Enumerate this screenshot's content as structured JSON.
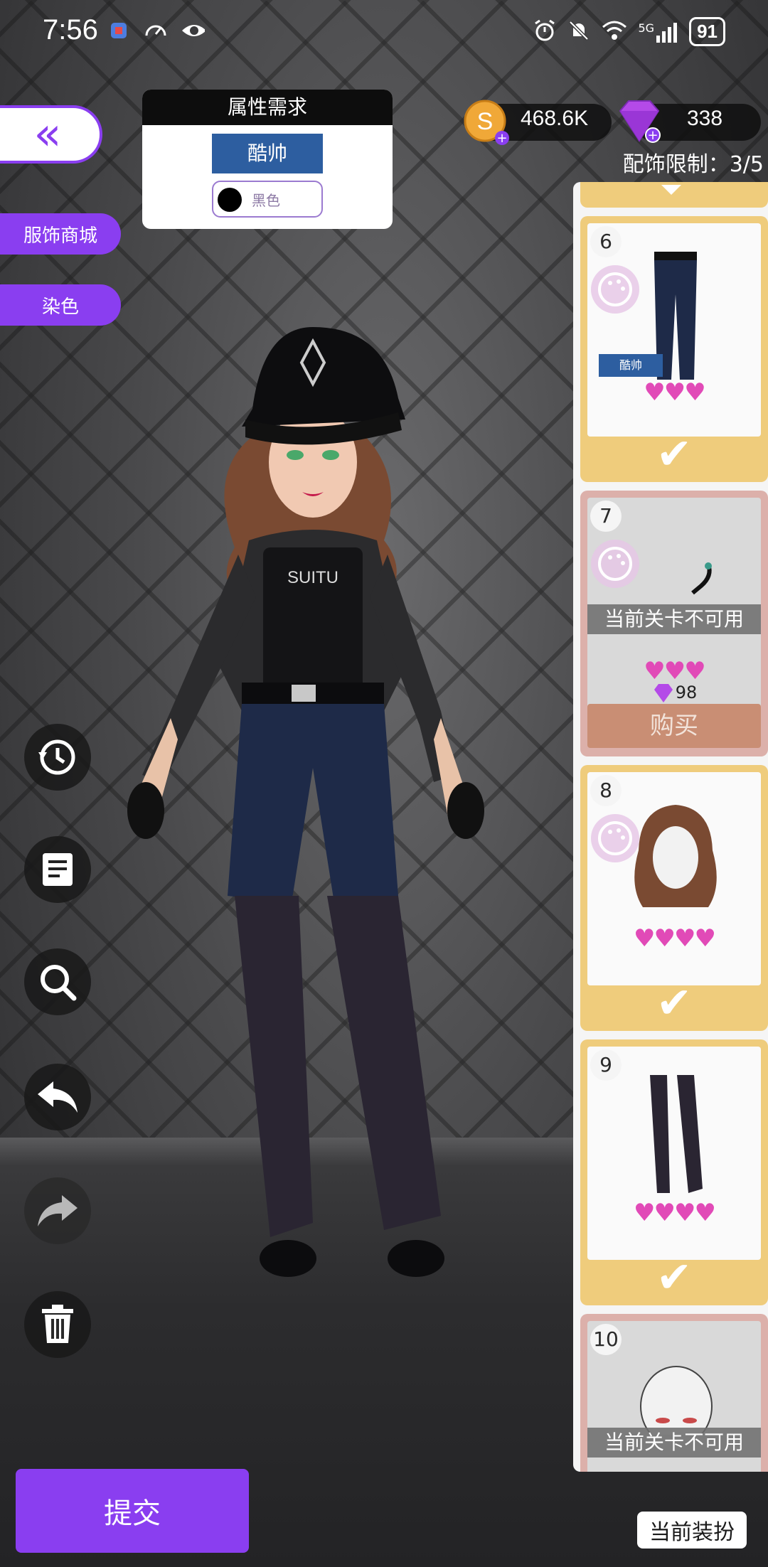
{
  "status_bar": {
    "time": "7:56",
    "network": "5G",
    "battery": "91"
  },
  "back_button_label": "«",
  "side_buttons": [
    "服饰商城",
    "染色"
  ],
  "requirement": {
    "title": "属性需求",
    "style_tag": "酷帅",
    "color_label": "黑色",
    "color": "#000000"
  },
  "currency": {
    "coins": "468.6K",
    "gems": "338"
  },
  "accessory_limit": "配饰限制：3/5",
  "items": [
    {
      "number": "6",
      "tag": "酷帅",
      "hearts": "♥♥♥",
      "state": "owned"
    },
    {
      "number": "7",
      "locked_text": "当前关卡不可用",
      "hearts": "♥♥♥",
      "price": "98",
      "buy_label": "购买",
      "state": "locked"
    },
    {
      "number": "8",
      "hearts": "♥♥♥♥",
      "state": "owned"
    },
    {
      "number": "9",
      "hearts": "♥♥♥♥",
      "state": "owned"
    },
    {
      "number": "10",
      "locked_text": "当前关卡不可用",
      "state": "locked"
    }
  ],
  "character_vest_text": "SUITU",
  "submit_label": "提交",
  "current_outfit_label": "当前装扮",
  "colors": {
    "accent": "#8a3ef0",
    "tag_blue": "#2d5ea0",
    "heart": "#e14ab7",
    "owned_card": "#efcc7c",
    "locked_card": "#dcb0aa"
  }
}
